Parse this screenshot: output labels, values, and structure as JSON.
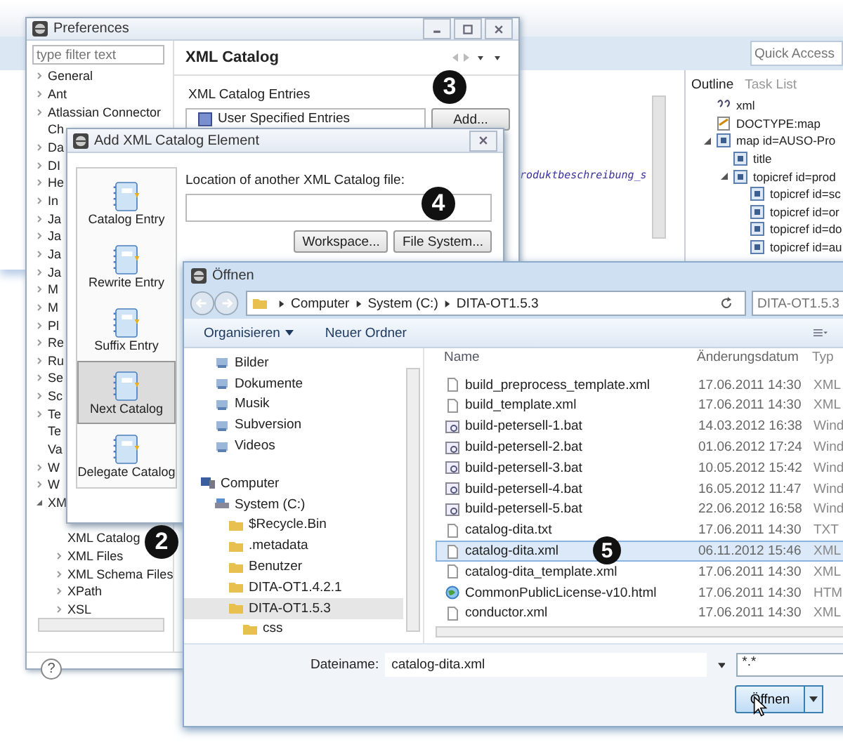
{
  "workbench": {
    "quick_access": {
      "placeholder": "Quick Access"
    },
    "editor_line": "roduktbeschreibung_s",
    "outline": {
      "tabs": [
        {
          "label": "Outline",
          "selected": true
        },
        {
          "label": "Task List",
          "selected": false
        }
      ],
      "tree": [
        {
          "label": "xml",
          "kind": "pi"
        },
        {
          "label": "DOCTYPE:map",
          "kind": "doctype"
        },
        {
          "label": "map id=AUSO-Pro",
          "kind": "element",
          "expanded": true,
          "children": [
            {
              "label": "title",
              "kind": "element"
            },
            {
              "label": "topicref id=prod",
              "kind": "element",
              "expanded": true,
              "children": [
                {
                  "label": "topicref id=sc",
                  "kind": "element"
                },
                {
                  "label": "topicref id=or",
                  "kind": "element"
                },
                {
                  "label": "topicref id=do",
                  "kind": "element"
                },
                {
                  "label": "topicref id=au",
                  "kind": "element"
                }
              ]
            }
          ]
        }
      ]
    }
  },
  "preferences": {
    "title": "Preferences",
    "filter": {
      "placeholder": "type filter text"
    },
    "tree": [
      {
        "label": "General",
        "expanded": false
      },
      {
        "label": "Ant",
        "expanded": false
      },
      {
        "label": "Atlassian Connector",
        "expanded": false
      },
      {
        "label": "Ch"
      },
      {
        "label": "Da",
        "expanded": false
      },
      {
        "label": "DI",
        "expanded": false
      },
      {
        "label": "He",
        "expanded": false
      },
      {
        "label": "In",
        "expanded": false
      },
      {
        "label": "Ja",
        "expanded": false
      },
      {
        "label": "Ja",
        "expanded": false
      },
      {
        "label": "Ja",
        "expanded": false
      },
      {
        "label": "Ja",
        "expanded": false
      },
      {
        "label": "M",
        "expanded": false
      },
      {
        "label": "M",
        "expanded": false
      },
      {
        "label": "Pl",
        "expanded": false
      },
      {
        "label": "Re",
        "expanded": false
      },
      {
        "label": "Ru",
        "expanded": false
      },
      {
        "label": "Se",
        "expanded": false
      },
      {
        "label": "Sc",
        "expanded": false
      },
      {
        "label": "Te",
        "expanded": false
      },
      {
        "label": "Te"
      },
      {
        "label": "Va"
      },
      {
        "label": "W",
        "expanded": false
      },
      {
        "label": "W",
        "expanded": false
      },
      {
        "label": "XM",
        "expanded": true,
        "children": [
          {
            "label": "XML Catalog"
          },
          {
            "label": "XML Files",
            "expanded": false
          },
          {
            "label": "XML Schema Files",
            "expanded": false
          },
          {
            "label": "XPath",
            "expanded": false
          },
          {
            "label": "XSL",
            "expanded": false
          }
        ]
      }
    ],
    "page_title": "XML Catalog",
    "entries_label": "XML Catalog Entries",
    "entries": [
      "User Specified Entries"
    ],
    "add_button": "Add...",
    "help_button": "?"
  },
  "add_dialog": {
    "title": "Add XML Catalog Element",
    "palette": [
      {
        "label": "Catalog Entry",
        "selected": false
      },
      {
        "label": "Rewrite Entry",
        "selected": false
      },
      {
        "label": "Suffix Entry",
        "selected": false
      },
      {
        "label": "Next Catalog",
        "selected": true
      },
      {
        "label": "Delegate Catalog",
        "selected": false
      }
    ],
    "location_label": "Location of another XML Catalog file:",
    "buttons": [
      "Workspace...",
      "File System..."
    ]
  },
  "open_dialog": {
    "title": "Öffnen",
    "breadcrumb": [
      "Computer",
      "System (C:)",
      "DITA-OT1.5.3"
    ],
    "search": {
      "placeholder": "DITA-OT1.5.3"
    },
    "toolbar": [
      {
        "label": "Organisieren",
        "dropdown": true
      },
      {
        "label": "Neuer Ordner",
        "dropdown": false
      }
    ],
    "favorites": [
      {
        "label": "Bilder"
      },
      {
        "label": "Dokumente"
      },
      {
        "label": "Musik"
      },
      {
        "label": "Subversion"
      },
      {
        "label": "Videos"
      }
    ],
    "nav_tree": [
      {
        "label": "Computer",
        "selected": false,
        "children": [
          {
            "label": "System (C:)",
            "selected": false,
            "children": [
              {
                "label": "$Recycle.Bin",
                "selected": false
              },
              {
                "label": ".metadata",
                "selected": false
              },
              {
                "label": "Benutzer",
                "selected": false
              },
              {
                "label": "DITA-OT1.4.2.1",
                "selected": false
              },
              {
                "label": "DITA-OT1.5.3",
                "selected": true,
                "children": [
                  {
                    "label": "css",
                    "selected": false
                  }
                ]
              }
            ]
          }
        ]
      }
    ],
    "columns": [
      "Name",
      "Änderungsdatum",
      "Typ"
    ],
    "files": [
      {
        "name": "build_preprocess_template.xml",
        "modified": "17.06.2011 14:30",
        "type": "XML",
        "kind": "document",
        "selected": false
      },
      {
        "name": "build_template.xml",
        "modified": "17.06.2011 14:30",
        "type": "XML",
        "kind": "document",
        "selected": false
      },
      {
        "name": "build-petersell-1.bat",
        "modified": "14.03.2012 16:38",
        "type": "Wind",
        "kind": "batch",
        "selected": false
      },
      {
        "name": "build-petersell-2.bat",
        "modified": "01.06.2012 17:24",
        "type": "Wind",
        "kind": "batch",
        "selected": false
      },
      {
        "name": "build-petersell-3.bat",
        "modified": "10.05.2012 15:42",
        "type": "Wind",
        "kind": "batch",
        "selected": false
      },
      {
        "name": "build-petersell-4.bat",
        "modified": "16.05.2012 11:47",
        "type": "Wind",
        "kind": "batch",
        "selected": false
      },
      {
        "name": "build-petersell-5.bat",
        "modified": "22.06.2012 16:58",
        "type": "Wind",
        "kind": "batch",
        "selected": false
      },
      {
        "name": "catalog-dita.txt",
        "modified": "17.06.2011 14:30",
        "type": "TXT",
        "kind": "document",
        "selected": false
      },
      {
        "name": "catalog-dita.xml",
        "modified": "06.11.2012 15:46",
        "type": "XML",
        "kind": "document",
        "selected": true
      },
      {
        "name": "catalog-dita_template.xml",
        "modified": "17.06.2011 14:30",
        "type": "XML",
        "kind": "document",
        "selected": false
      },
      {
        "name": "CommonPublicLicense-v10.html",
        "modified": "17.06.2011 14:30",
        "type": "HTM",
        "kind": "web",
        "selected": false
      },
      {
        "name": "conductor.xml",
        "modified": "17.06.2011 14:30",
        "type": "XML",
        "kind": "document",
        "selected": false
      }
    ],
    "filename_label": "Dateiname:",
    "filename": "catalog-dita.xml",
    "filter": "*.*",
    "open_button": "Öffnen"
  },
  "callouts": [
    "2",
    "3",
    "4",
    "5"
  ]
}
